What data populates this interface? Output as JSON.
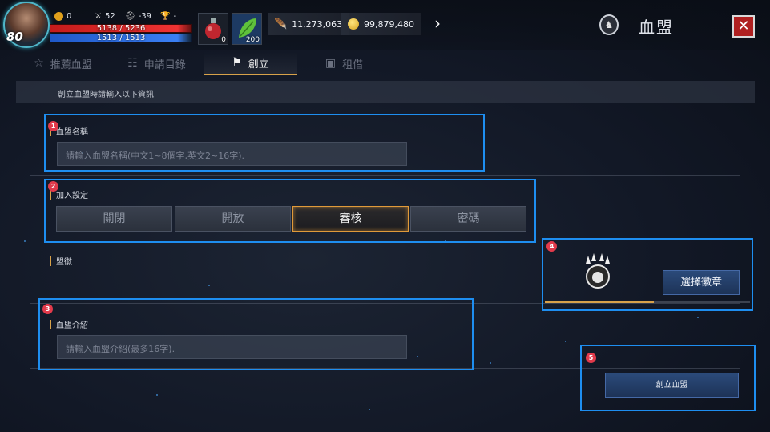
{
  "player": {
    "level": "80",
    "stat1": "0",
    "stat2": "52",
    "stat3": "-39",
    "stat4": "-",
    "hp": "5138 / 5236",
    "mp": "1513 / 1513"
  },
  "items": [
    {
      "icon": "potion-icon",
      "count": "0"
    },
    {
      "icon": "leaf-icon",
      "count": "200"
    }
  ],
  "currency": {
    "silver": "11,273,063",
    "gold": "99,879,480"
  },
  "header": {
    "title": "血盟"
  },
  "tabs": [
    {
      "label": "推薦血盟",
      "icon": "star-icon",
      "active": false
    },
    {
      "label": "申請目錄",
      "icon": "list-check-icon",
      "active": false
    },
    {
      "label": "創立",
      "icon": "flag-icon",
      "active": true
    },
    {
      "label": "租借",
      "icon": "rent-icon",
      "active": false
    }
  ],
  "form": {
    "instruction": "創立血盟時請輸入以下資訊",
    "name_label": "血盟名稱",
    "name_placeholder": "請輸入血盟名稱(中文1~8個字,英文2~16字).",
    "join_label": "加入設定",
    "join_options": [
      "關閉",
      "開放",
      "審核",
      "密碼"
    ],
    "join_selected": "審核",
    "emblem_label": "盟徽",
    "select_emblem_button": "選擇徽章",
    "intro_label": "血盟介紹",
    "intro_placeholder": "請輸入血盟介紹(最多16字).",
    "create_button": "創立血盟",
    "emblem_progress": 0.53
  },
  "annotations": [
    "1",
    "2",
    "3",
    "4",
    "5"
  ],
  "colors": {
    "highlight": "#1e8ef0",
    "accent": "#d8a24a",
    "badge": "#e23a4b"
  }
}
